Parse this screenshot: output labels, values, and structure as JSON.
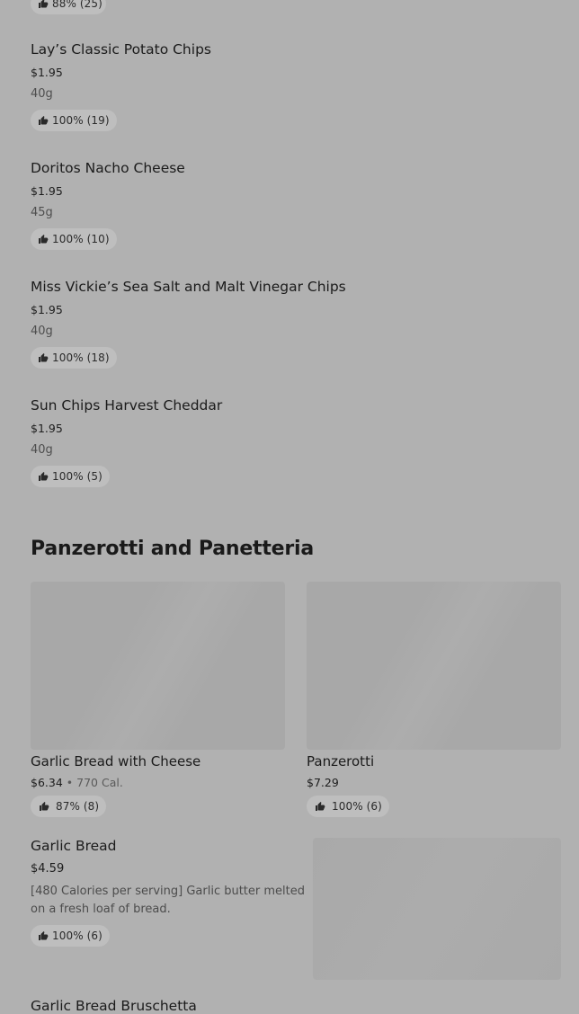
{
  "top_partial": {
    "rating": "88% (25)"
  },
  "items": [
    {
      "name": "Lay’s Classic Potato Chips",
      "price": "$1.95",
      "size": "40g",
      "rating": "100% (19)"
    },
    {
      "name": "Doritos Nacho Cheese",
      "price": "$1.95",
      "size": "45g",
      "rating": "100% (10)"
    },
    {
      "name": "Miss Vickie’s Sea Salt and Malt Vinegar Chips",
      "price": "$1.95",
      "size": "40g",
      "rating": "100% (18)"
    },
    {
      "name": "Sun Chips Harvest Cheddar",
      "price": "$1.95",
      "size": "40g",
      "rating": "100% (5)"
    }
  ],
  "section": {
    "title": "Panzerotti and Panetteria"
  },
  "cards": [
    {
      "name": "Garlic Bread with Cheese",
      "price": "$6.34",
      "separator": "•",
      "calories": "770 Cal.",
      "rating": "87% (8)"
    },
    {
      "name": "Panzerotti",
      "price": "$7.29",
      "rating": "100% (6)"
    }
  ],
  "list_item": {
    "name": "Garlic Bread",
    "price": "$4.59",
    "description": "[480 Calories per serving] Garlic butter melted on a fresh loaf of bread.",
    "rating": "100% (6)"
  },
  "bottom_partial": {
    "name": "Garlic Bread Bruschetta"
  },
  "icons": {
    "rating": "thumbs-up-icon"
  },
  "colors": {
    "background": "#b1b1b1",
    "pill": "#bebebe",
    "image_placeholder": "#a8a8a8",
    "text": "#1b1b1b",
    "muted_text": "#4e4e4e"
  }
}
